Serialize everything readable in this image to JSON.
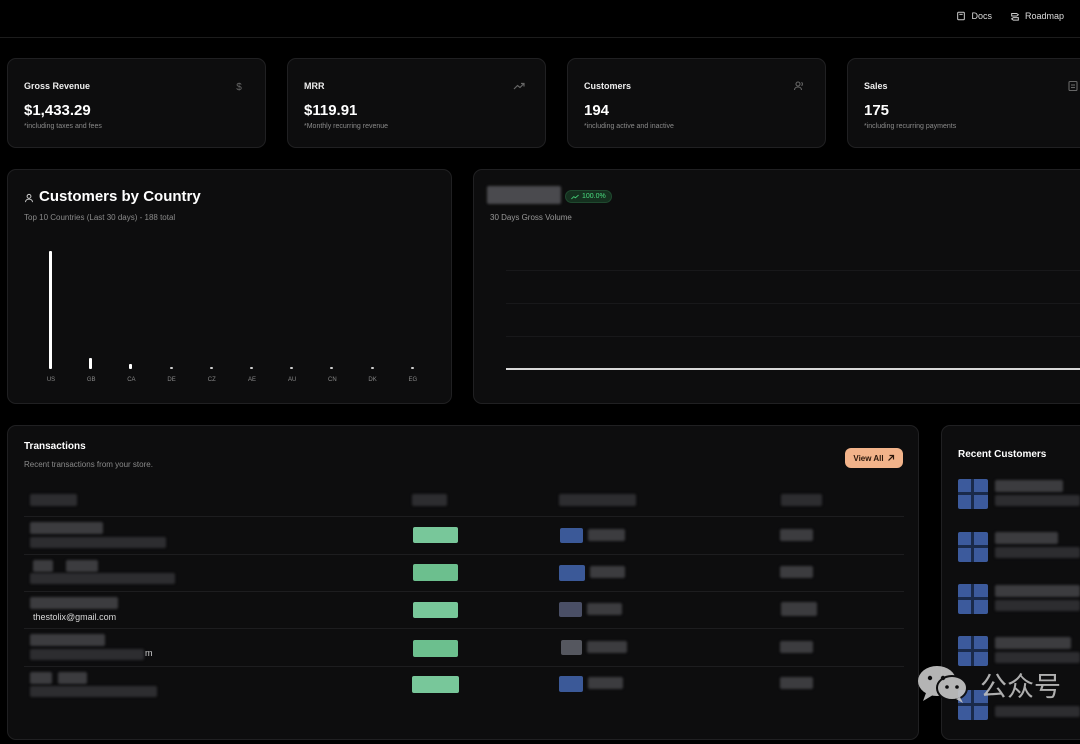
{
  "topnav": {
    "docs": "Docs",
    "roadmap": "Roadmap"
  },
  "stats": [
    {
      "label": "Gross Revenue",
      "value": "$1,433.29",
      "sub": "*including taxes and fees",
      "icon": "dollar-icon"
    },
    {
      "label": "MRR",
      "value": "$119.91",
      "sub": "*Monthly recurring revenue",
      "icon": "trending-up-icon"
    },
    {
      "label": "Customers",
      "value": "194",
      "sub": "*including active and inactive",
      "icon": "users-icon"
    },
    {
      "label": "Sales",
      "value": "175",
      "sub": "*including recurring payments",
      "icon": "receipt-icon"
    }
  ],
  "country_panel": {
    "title": "Customers by Country",
    "subtitle": "Top 10 Countries (Last 30 days) - 188 total"
  },
  "chart_data": {
    "type": "bar",
    "categories": [
      "US",
      "GB",
      "CA",
      "DE",
      "CZ",
      "AE",
      "AU",
      "CN",
      "DK",
      "EG"
    ],
    "values": [
      150,
      14,
      6,
      3,
      2,
      1,
      1,
      1,
      1,
      1
    ],
    "ylim": [
      0,
      150
    ],
    "grid": false,
    "legend": "none"
  },
  "volume_panel": {
    "badge": "100.0%",
    "subtitle": "30 Days Gross Volume"
  },
  "transactions": {
    "title": "Transactions",
    "subtitle": "Recent transactions from your store.",
    "view_all": "View All",
    "visible_email": "thestolix@gmail.com",
    "partial_text": "m"
  },
  "recent_customers": {
    "title": "Recent Customers"
  },
  "watermark": {
    "text": "公众号"
  },
  "colors": {
    "accent": "#f2b38a",
    "status_green": "#78c79a",
    "avatar_blue": "#3b5998",
    "badge_green": "#4ade80"
  }
}
